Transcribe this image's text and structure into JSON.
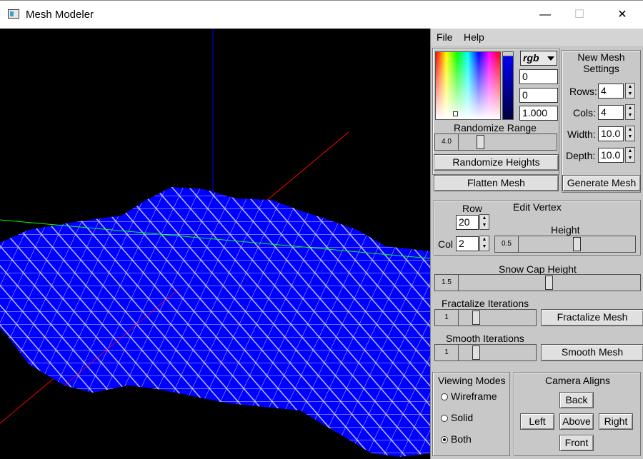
{
  "window": {
    "title": "Mesh Modeler",
    "minimize": "—",
    "maximize": "☐",
    "close": "✕"
  },
  "menu": {
    "file": "File",
    "help": "Help"
  },
  "color": {
    "mode": "rgb",
    "v1": "0",
    "v2": "0",
    "v3": "1.000"
  },
  "randomize": {
    "label": "Randomize Range",
    "value": "4.0",
    "level": 0.2,
    "button": "Randomize Heights"
  },
  "new_mesh": {
    "title": "New Mesh Settings",
    "rows_label": "Rows:",
    "rows": "4",
    "cols_label": "Cols:",
    "cols": "4",
    "width_label": "Width:",
    "width": "10.0",
    "depth_label": "Depth:",
    "depth": "10.0"
  },
  "flatten_button": "Flatten Mesh",
  "generate_button": "Generate Mesh",
  "edit_vertex": {
    "title": "Edit Vertex",
    "row_label": "Row",
    "row": "20",
    "col_label": "Col",
    "col": "2",
    "height_label": "Height",
    "height": "0.5",
    "level": 0.5
  },
  "snow_cap": {
    "label": "Snow Cap Height",
    "value": "1.5",
    "level": 0.5
  },
  "fractalize": {
    "label": "Fractalize Iterations",
    "value": "1",
    "level": 0.2,
    "button": "Fractalize Mesh"
  },
  "smooth": {
    "label": "Smooth Iterations",
    "value": "1",
    "level": 0.2,
    "button": "Smooth Mesh"
  },
  "viewing_modes": {
    "title": "Viewing Modes",
    "options": [
      "Wireframe",
      "Solid",
      "Both"
    ],
    "selected": "Both"
  },
  "camera": {
    "title": "Camera Aligns",
    "back": "Back",
    "left": "Left",
    "above": "Above",
    "right": "Right",
    "front": "Front"
  },
  "colors": {
    "mesh": "#0000ff",
    "wire": "#ffffff",
    "axis_x": "#ff0000",
    "axis_y": "#0000ff",
    "axis_z": "#00ff00"
  }
}
